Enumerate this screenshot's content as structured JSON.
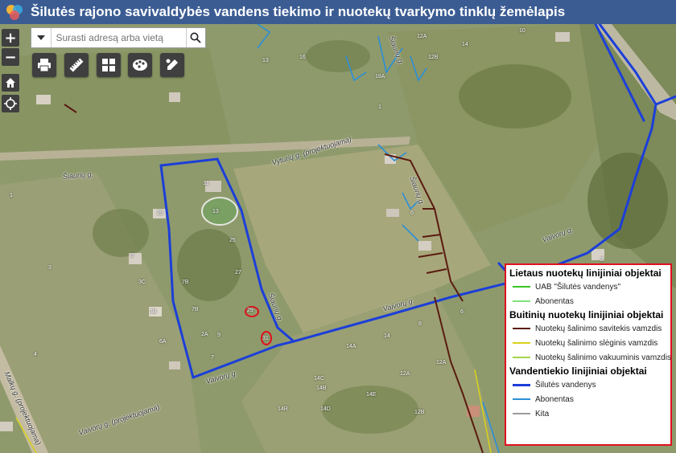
{
  "header": {
    "title": "Šilutės rajono savivaldybės vandens tiekimo ir nuotekų tvarkymo tinklų žemėlapis"
  },
  "search": {
    "placeholder": "Surasti adresą arba vietą"
  },
  "zoom": {
    "in_label": "+",
    "out_label": "−"
  },
  "toolbar": {
    "icons": [
      "print-icon",
      "measure-icon",
      "basemap-gallery-icon",
      "layers-icon",
      "draw-icon"
    ]
  },
  "nav": {
    "icons": [
      "home-icon",
      "locate-icon"
    ]
  },
  "streets": {
    "vyturiu": "Vyturių g. (projektuojama)",
    "siauriu_top": "Šiaurių g.",
    "siauriu_mid": "Šiaurių g.",
    "sizy": "Šiaurių g.",
    "vaivoru": "Vaivorų g.",
    "vaivoru2": "Vaivorų g.",
    "vaivoru3": "Vaivorų g. (projektuojama)",
    "vaivoru_top": "Vaivorų g.",
    "malku": "Malkų g. (projektuojama)",
    "sizu": "Šiaurių g."
  },
  "parcel_labels": [
    "12A",
    "14",
    "10",
    "12B",
    "13",
    "16",
    "1",
    "18A",
    "31",
    "13",
    "29",
    "25",
    "27",
    "7B",
    "7B",
    "3C",
    "3B",
    "8",
    "29",
    "31",
    "9",
    "6",
    "6A",
    "3",
    "2A",
    "7",
    "14A",
    "14C",
    "14B",
    "14E",
    "14R",
    "14D",
    "12B",
    "12A",
    "12A",
    "8",
    "14",
    "6",
    "2",
    "1",
    "4"
  ],
  "legend": {
    "rain_title": "Lietaus nuotekų linijiniai objektai",
    "rain_items": [
      {
        "label": "UAB \"Šilutės vandenys\"",
        "color": "#39c421"
      },
      {
        "label": "Abonentas",
        "color": "#7fe37a"
      }
    ],
    "sewer_title": "Buitinių nuotekų linijiniai objektai",
    "sewer_items": [
      {
        "label": "Nuotekų šalinimo savitekis vamzdis",
        "color": "#5a1b10"
      },
      {
        "label": "Nuotekų šalinimo slėginis vamzdis",
        "color": "#d8d21a"
      },
      {
        "label": "Nuotekų šalinimo vakuuminis vamzdis",
        "color": "#a4d64a"
      }
    ],
    "water_title": "Vandentiekio linijiniai objektai",
    "water_items": [
      {
        "label": "Šilutės vandenys",
        "color": "#1c3fd8"
      },
      {
        "label": "Abonentas",
        "color": "#2a8fd8"
      },
      {
        "label": "Kita",
        "color": "#9a9a9a"
      }
    ]
  },
  "colors": {
    "header_bg": "#3b5c93",
    "water_main": "#1c3fd8",
    "water_subscriber": "#2a8fd8",
    "sewer_gravity": "#5a1b10",
    "highlight": "#e0101e"
  }
}
